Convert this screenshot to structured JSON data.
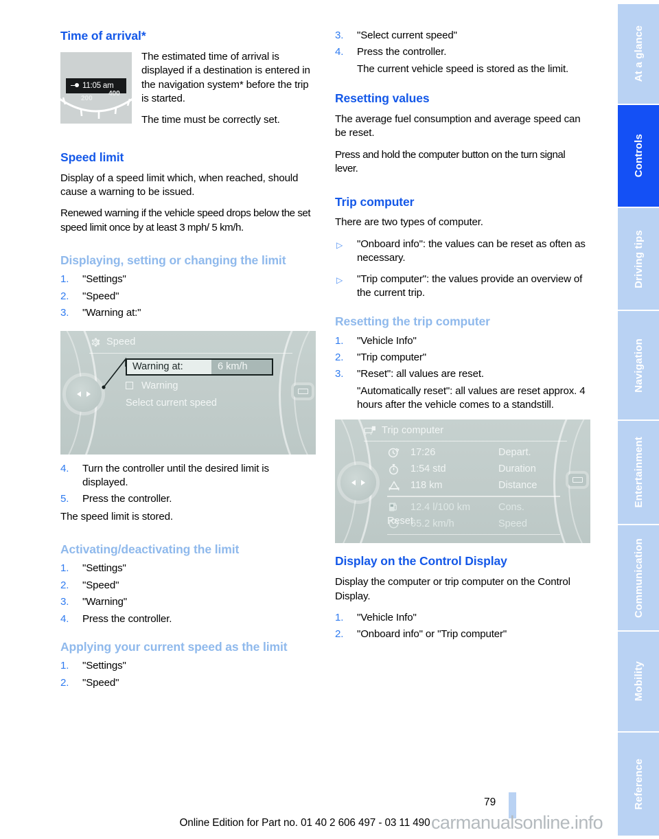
{
  "page": {
    "number": "79",
    "footer_note": "Online Edition for Part no. 01 40 2 606 497 - 03 11 490",
    "watermark": "carmanualsonline.info"
  },
  "colors": {
    "heading_primary": "#1458e8",
    "heading_secondary": "#8fb9ec",
    "list_number": "#2f7bf0",
    "tab_inactive": "#b9d2f3",
    "tab_active": "#1450f5",
    "screen_bg": "#c3cfcd"
  },
  "left_column": {
    "time_of_arrival": {
      "heading": "Time of arrival*",
      "paragraphs": [
        "The estimated time of arrival is displayed if a destination is entered in the navigation system* before the trip is started.",
        "The time must be correctly set."
      ],
      "figure": {
        "lcd_time": "11:05 am",
        "scale_labels": [
          "200",
          "400"
        ]
      }
    },
    "speed_limit": {
      "heading": "Speed limit",
      "paragraphs": [
        "Display of a speed limit which, when reached, should cause a warning to be issued.",
        "Renewed warning if the vehicle speed drops below the set speed limit once by at least 3 mph/ 5 km/h."
      ]
    },
    "displaying_setting": {
      "heading": "Displaying, setting or changing the limit",
      "steps": [
        "\"Settings\"",
        "\"Speed\"",
        "\"Warning at:\""
      ],
      "steps_after": [
        {
          "num": "4.",
          "text": "Turn the controller until the desired limit is displayed."
        },
        {
          "num": "5.",
          "text": "Press the controller."
        }
      ],
      "closing": "The speed limit is stored.",
      "figure": {
        "title": "Speed",
        "title_icon": "gear-icon",
        "row_label": "Warning at:",
        "row_value": "6 km/h",
        "checkbox_label": "Warning",
        "option_label": "Select current speed"
      }
    },
    "activating": {
      "heading": "Activating/deactivating the limit",
      "steps": [
        "\"Settings\"",
        "\"Speed\"",
        "\"Warning\"",
        "Press the controller."
      ]
    },
    "applying": {
      "heading": "Applying your current speed as the limit",
      "steps": [
        "\"Settings\"",
        "\"Speed\""
      ]
    }
  },
  "right_column": {
    "applying_cont": {
      "steps": [
        {
          "num": "3.",
          "text": "\"Select current speed\""
        },
        {
          "num": "4.",
          "text": "Press the controller."
        }
      ],
      "note": "The current vehicle speed is stored as the limit."
    },
    "resetting_values": {
      "heading": "Resetting values",
      "paragraphs": [
        "The average fuel consumption and average speed can be reset.",
        "Press and hold the computer button on the turn signal lever."
      ]
    },
    "trip_computer": {
      "heading": "Trip computer",
      "intro": "There are two types of computer.",
      "bullets": [
        "\"Onboard info\": the values can be reset as often as necessary.",
        "\"Trip computer\": the values provide an overview of the current trip."
      ]
    },
    "resetting_trip_computer": {
      "heading": "Resetting the trip computer",
      "steps": [
        "\"Vehicle Info\"",
        "\"Trip computer\"",
        "\"Reset\": all values are reset."
      ],
      "note": "\"Automatically reset\": all values are reset approx. 4 hours after the vehicle comes to a standstill.",
      "figure": {
        "title": "Trip computer",
        "title_icon": "car-display-icon",
        "rows": [
          {
            "icon": "clock-arrow-icon",
            "value": "17:26",
            "label": "Depart.",
            "dim": false
          },
          {
            "icon": "stopwatch-icon",
            "value": "1:54 std",
            "label": "Duration",
            "dim": false
          },
          {
            "icon": "distance-icon",
            "value": "118 km",
            "label": "Distance",
            "dim": false
          },
          {
            "icon": "fuel-pump-icon",
            "value": "12.4 l/100 km",
            "label": "Cons.",
            "dim": true
          },
          {
            "icon": "speedometer-icon",
            "value": "65.2 km/h",
            "label": "Speed",
            "dim": true
          }
        ],
        "reset_label": "Reset"
      }
    },
    "display_on_control_display": {
      "heading": "Display on the Control Display",
      "paragraph": "Display the computer or trip computer on the Control Display.",
      "steps": [
        "\"Vehicle Info\"",
        "\"Onboard info\" or \"Trip computer\""
      ]
    }
  },
  "sidebar": {
    "tabs": [
      {
        "label": "At a glance",
        "active": false
      },
      {
        "label": "Controls",
        "active": true
      },
      {
        "label": "Driving tips",
        "active": false
      },
      {
        "label": "Navigation",
        "active": false
      },
      {
        "label": "Entertainment",
        "active": false
      },
      {
        "label": "Communication",
        "active": false
      },
      {
        "label": "Mobility",
        "active": false
      },
      {
        "label": "Reference",
        "active": false
      }
    ]
  }
}
